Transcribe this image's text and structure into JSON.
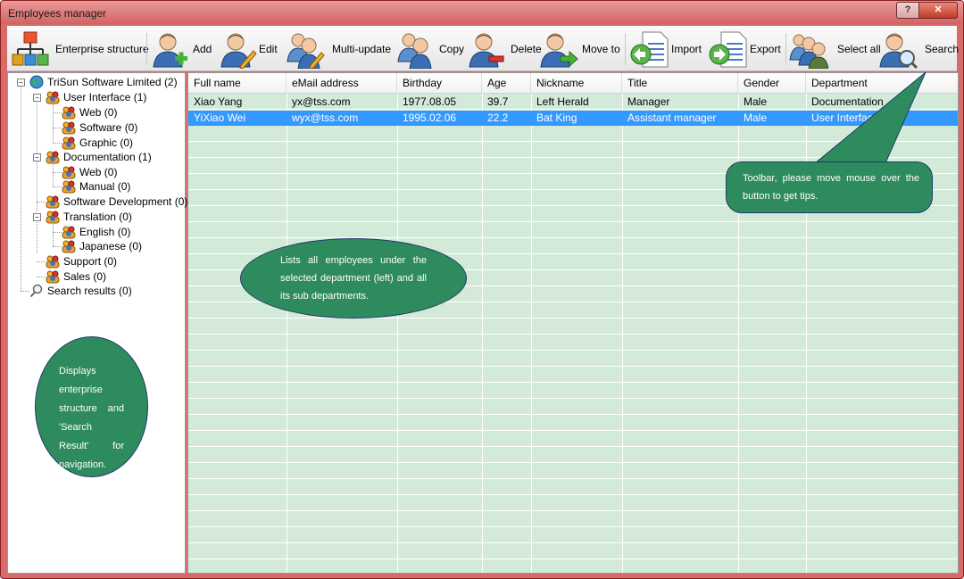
{
  "window": {
    "title": "Employees manager",
    "help_label": "?",
    "close_label": "✕"
  },
  "toolbar": {
    "buttons": [
      {
        "label": "Enterprise structure",
        "icon": "org-chart-icon"
      },
      {
        "label": "Add",
        "icon": "user-add-icon"
      },
      {
        "label": "Edit",
        "icon": "user-edit-icon"
      },
      {
        "label": "Multi-update",
        "icon": "users-edit-icon"
      },
      {
        "label": "Copy",
        "icon": "users-copy-icon"
      },
      {
        "label": "Delete",
        "icon": "user-delete-icon"
      },
      {
        "label": "Move to",
        "icon": "user-move-icon"
      },
      {
        "label": "Import",
        "icon": "import-icon"
      },
      {
        "label": "Export",
        "icon": "export-icon"
      },
      {
        "label": "Select all",
        "icon": "users-group-icon"
      },
      {
        "label": "Search",
        "icon": "user-search-icon"
      }
    ]
  },
  "tree": {
    "items": [
      {
        "label": "TriSun Software Limited (2)",
        "icon": "globe-icon"
      },
      {
        "label": "User Interface (1)",
        "icon": "department-icon"
      },
      {
        "label": "Web (0)",
        "icon": "department-icon"
      },
      {
        "label": "Software (0)",
        "icon": "department-icon"
      },
      {
        "label": "Graphic (0)",
        "icon": "department-icon"
      },
      {
        "label": "Documentation (1)",
        "icon": "department-icon"
      },
      {
        "label": "Web (0)",
        "icon": "department-icon"
      },
      {
        "label": "Manual (0)",
        "icon": "department-icon"
      },
      {
        "label": "Software Development (0)",
        "icon": "department-icon"
      },
      {
        "label": "Translation (0)",
        "icon": "department-icon"
      },
      {
        "label": "English (0)",
        "icon": "department-icon"
      },
      {
        "label": "Japanese (0)",
        "icon": "department-icon"
      },
      {
        "label": "Support (0)",
        "icon": "department-icon"
      },
      {
        "label": "Sales (0)",
        "icon": "department-icon"
      },
      {
        "label": "Search results (0)",
        "icon": "magnifier-icon"
      }
    ]
  },
  "grid": {
    "columns": [
      "Full name",
      "eMail address",
      "Birthday",
      "Age",
      "Nickname",
      "Title",
      "Gender",
      "Department"
    ],
    "rows": [
      {
        "cells": [
          "Xiao Yang",
          "yx@tss.com",
          "1977.08.05",
          "39.7",
          "Left Herald",
          "Manager",
          "Male",
          "Documentation"
        ],
        "selected": false
      },
      {
        "cells": [
          "YiXiao Wei",
          "wyx@tss.com",
          "1995.02.06",
          "22.2",
          "Bat King",
          "Assistant manager",
          "Male",
          "User Interface"
        ],
        "selected": true
      }
    ]
  },
  "callouts": {
    "toolbar": "Toolbar, please move mouse over the button to get tips.",
    "grid": "Lists all employees under the selected department (left) and all its sub departments.",
    "tree": "Displays enterprise structure and 'Search Result' for navigation."
  },
  "colors": {
    "title_bar": "#d96a6a",
    "grid_row": "#d4ead9",
    "selection": "#3399ff",
    "callout": "#2e8b5e"
  }
}
